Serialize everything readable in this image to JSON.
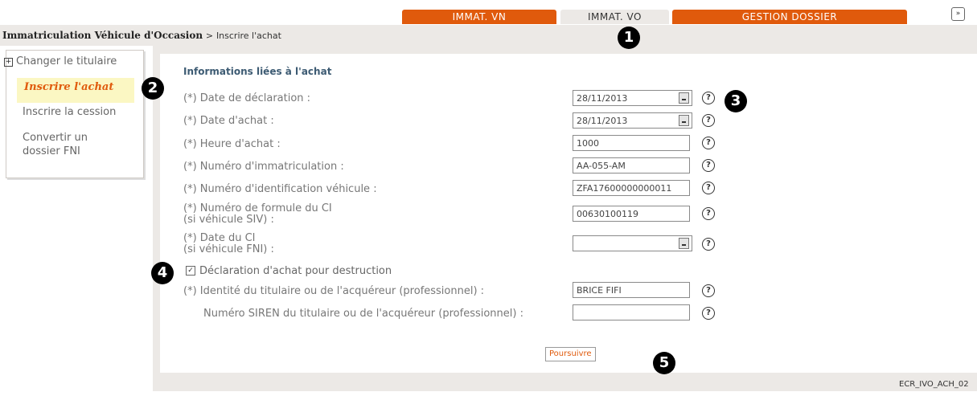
{
  "tabs": [
    {
      "label": "IMMAT. VN"
    },
    {
      "label": "IMMAT. VO"
    },
    {
      "label": "GESTION DOSSIER"
    }
  ],
  "expand_icon": "chevron-double-down-icon",
  "breadcrumb": {
    "root": "Immatriculation Véhicule d'Occasion",
    "separator": ">",
    "current": "Inscrire l'achat"
  },
  "sidebar": {
    "items": [
      {
        "label": "Changer le titulaire"
      },
      {
        "label": "Inscrire l'achat"
      },
      {
        "label": "Inscrire la cession"
      },
      {
        "label": "Convertir un dossier FNI"
      }
    ]
  },
  "form": {
    "title": "Informations liées à l'achat",
    "fields": [
      {
        "label": "(*) Date de déclaration :",
        "value": "28/11/2013"
      },
      {
        "label": "(*) Date d'achat :",
        "value": "28/11/2013"
      },
      {
        "label": "(*) Heure d'achat  :",
        "value": "1000"
      },
      {
        "label": "(*) Numéro d'immatriculation :",
        "value": "AA-055-AM"
      },
      {
        "label": "(*) Numéro d'identification véhicule :",
        "value": "ZFA17600000000011"
      },
      {
        "label": "(*) Numéro de formule du CI",
        "sublabel": "(si véhicule SIV) :",
        "value": "00630100119"
      },
      {
        "label": "(*) Date du CI",
        "sublabel": "(si véhicule FNI) :",
        "value": ""
      },
      {
        "label": "(*) Identité du titulaire ou de l'acquéreur (professionnel) :",
        "value": "BRICE FIFI"
      },
      {
        "label": "Numéro SIREN du titulaire ou de l'acquéreur (professionnel) :",
        "value": ""
      }
    ],
    "checkbox": {
      "label": "Déclaration d'achat pour destruction",
      "checked": true
    },
    "submit_label": "Poursuivre"
  },
  "callouts": [
    "1",
    "2",
    "3",
    "4",
    "5"
  ],
  "screen_id": "ECR_IVO_ACH_02",
  "colors": {
    "accent": "#e05a0c",
    "tab_bg": "#ece9e6",
    "title": "#3d5b73",
    "highlight": "#fbf7c3"
  }
}
